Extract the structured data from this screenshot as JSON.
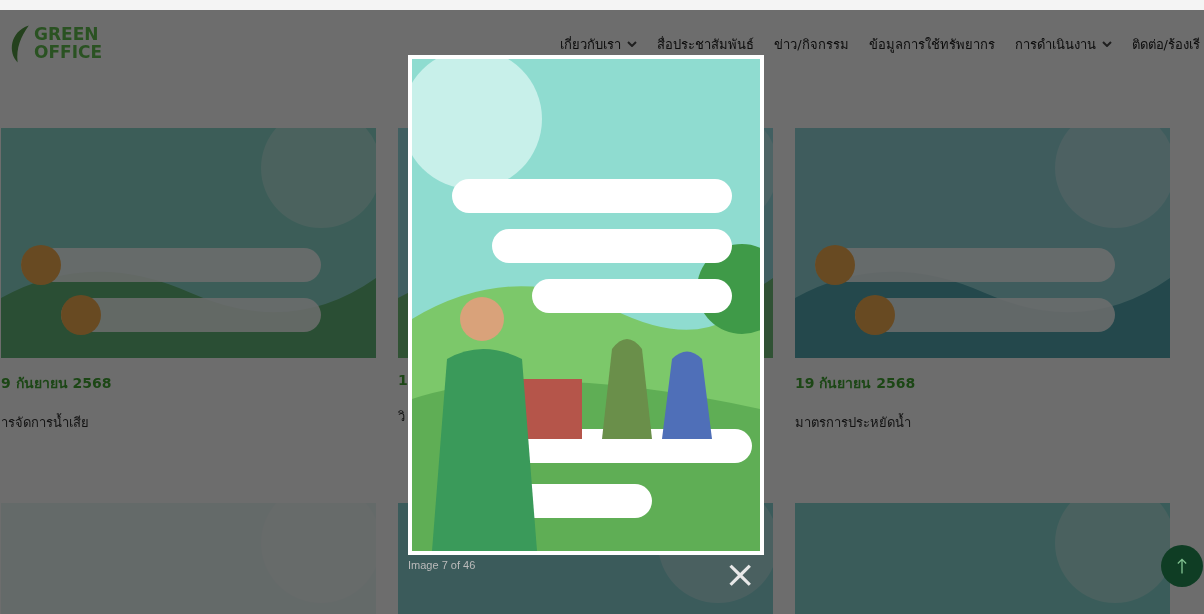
{
  "header": {
    "logo": "GREEN OFFICE",
    "nav": [
      {
        "label": "เกี่ยวกับเรา",
        "dropdown": true
      },
      {
        "label": "สื่อประชาสัมพันธ์",
        "dropdown": false
      },
      {
        "label": "ข่าว/กิจกรรม",
        "dropdown": false
      },
      {
        "label": "ข้อมูลการใช้ทรัพยากร",
        "dropdown": false
      },
      {
        "label": "การดำเนินงาน",
        "dropdown": true
      },
      {
        "label": "ติดต่อ/ร้องเรี",
        "dropdown": false
      }
    ]
  },
  "posts": [
    {
      "kind": "picture",
      "date": "9 กันยายน 2568",
      "title": "ารจัดการน้ำเสีย"
    },
    {
      "kind": "picture",
      "date": "1",
      "title": "วิ"
    },
    {
      "kind": "picture",
      "date": "19 กันยายน 2568",
      "title": "มาตรการประหยัดน้ำ"
    },
    {
      "kind": "picture"
    },
    {
      "kind": "picture"
    },
    {
      "kind": "picture"
    }
  ],
  "lightbox": {
    "kind": "picture",
    "caption": "Image 7 of 46",
    "close": "×"
  }
}
